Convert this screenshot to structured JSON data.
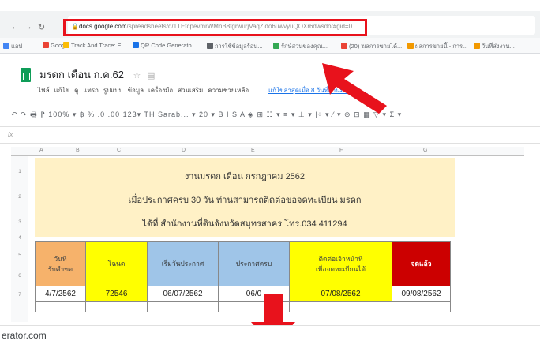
{
  "browser": {
    "url_host": "docs.google.com",
    "url_path": "/spreadsheets/d/1TEtcpevmrWMnB8tgrwurjVaqZldo6uwvyuQOXr6dwsdo/#gid=0",
    "bookmarks": [
      {
        "label": "แอป",
        "color": "#4285f4"
      },
      {
        "label": "Google",
        "color": "#ea4335"
      },
      {
        "label": "Track And Trace: E...",
        "color": "#fbbc04"
      },
      {
        "label": "QR Code Generato...",
        "color": "#1a73e8"
      },
      {
        "label": "การใช้ข้อมูลร้อน...",
        "color": "#5f6368"
      },
      {
        "label": "รักษ์สวนของคุณ...",
        "color": "#34a853"
      },
      {
        "label": "(20) 'ผลการขายได้...",
        "color": "#ea4335"
      },
      {
        "label": "ผลการขายนี้ - การ...",
        "color": "#f29900"
      },
      {
        "label": "วันที่ส่งงาน...",
        "color": "#f29900"
      }
    ]
  },
  "doc": {
    "title": "มรดก เดือน ก.ค.62",
    "menu": [
      "ไฟล์",
      "แก้ไข",
      "ดู",
      "แทรก",
      "รูปแบบ",
      "ข้อมูล",
      "เครื่องมือ",
      "ส่วนเสริม",
      "ความช่วยเหลือ"
    ],
    "last_edit": "แก้ไขล่าสุดเมื่อ 8 วันที่ผ่านมา โดย ...",
    "toolbar_text": "↶ ↷ 🖶 ⁋  100% ▾  ฿  %  .0  .00  123▾  TH Sarab... ▾  20 ▾  B  I  S  A  ◈  ⊞  ☷ ▾  ≡ ▾  ⊥ ▾  |÷ ▾  ⁄ ▾  ⊝  ⊡  ▦  ▽ ▾  Σ ▾",
    "fx": "fx"
  },
  "banner": {
    "line1": "งานมรดก เดือน กรกฎาคม 2562",
    "line2": "เมื่อประกาศครบ 30 วัน ท่านสามารถติดต่อขอจดทะเบียน มรดก",
    "line3": "ได้ที่ สำนักงานที่ดินจังหวัดสมุทรสาคร โทร.034 411294"
  },
  "table": {
    "headers": [
      {
        "label": "วันที่\nรับคำขอ",
        "bg": "#f6b26b"
      },
      {
        "label": "โฉนด",
        "bg": "#ffff00"
      },
      {
        "label": "เริ่มวันประกาศ",
        "bg": "#9fc5e8"
      },
      {
        "label": "ประกาศครบ",
        "bg": "#9fc5e8"
      },
      {
        "label": "ติดต่อเจ้าหน้าที่\nเพื่อจดทะเบียนได้",
        "bg": "#ffff00"
      },
      {
        "label": "จดแล้ว",
        "bg": "#cc0000"
      }
    ],
    "row1": [
      "4/7/2562",
      "72546",
      "06/07/2562",
      "06/0",
      "07/08/2562",
      "09/08/2562"
    ],
    "row1_colors": [
      "#ffffff",
      "#ffff00",
      "#ffffff",
      "#ffffff",
      "#ffff00",
      "#ffffff"
    ]
  },
  "footer": {
    "text": "erator.com"
  },
  "colors": {
    "highlight": "#e8121c",
    "arrow": "#e8121c",
    "banner_bg": "#fff1c6"
  }
}
